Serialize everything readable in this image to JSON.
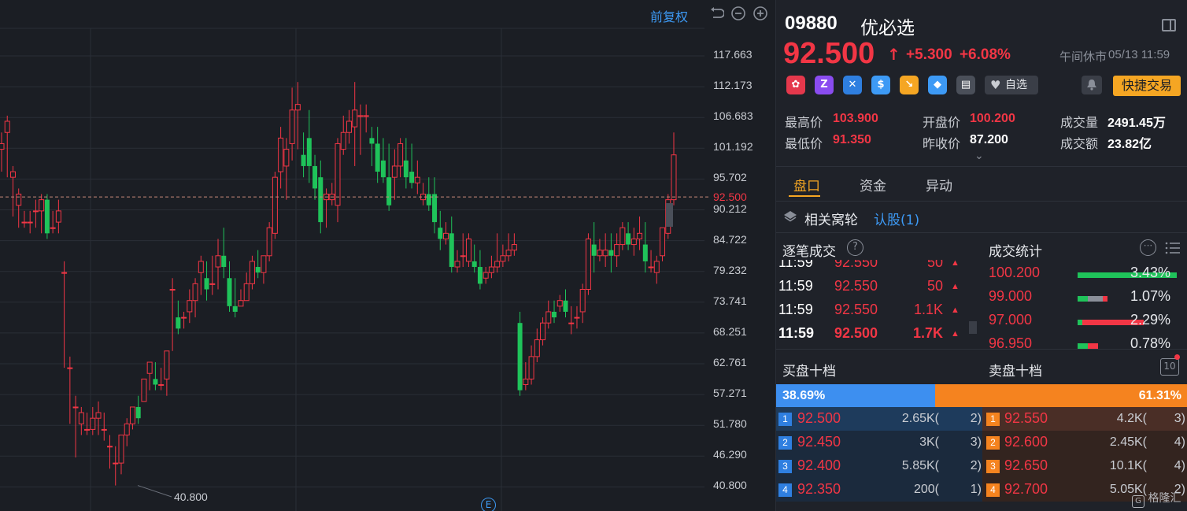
{
  "chart": {
    "adjust_label": "前复权",
    "y_ticks": [
      "117.663",
      "112.173",
      "106.683",
      "101.192",
      "95.702",
      "90.212",
      "84.722",
      "79.232",
      "73.741",
      "68.251",
      "62.761",
      "57.271",
      "51.780",
      "46.290",
      "40.800"
    ],
    "current_price_tag": "92.500",
    "low_label": "40.800",
    "event_icon": "E",
    "colors": {
      "up": "#f23645",
      "down": "#1fc35a",
      "grid": "#2a2e36"
    }
  },
  "chart_data": {
    "type": "candlestick",
    "y_range": [
      40.8,
      117.663
    ],
    "current_price": 92.5,
    "candles": [
      [
        101,
        104,
        102,
        97
      ],
      [
        104,
        107,
        106,
        96
      ],
      [
        96,
        98,
        97,
        89
      ],
      [
        91,
        94,
        93,
        87
      ],
      [
        88,
        90,
        88,
        87
      ],
      [
        88,
        90,
        88,
        86
      ],
      [
        90,
        92,
        90,
        87
      ],
      [
        90,
        93,
        92,
        86
      ],
      [
        92,
        93,
        86,
        85
      ],
      [
        87,
        90,
        87,
        86
      ],
      [
        88,
        92,
        90,
        86
      ],
      [
        79,
        81,
        79,
        62
      ],
      [
        62,
        64,
        62,
        52
      ],
      [
        55,
        57,
        55,
        46
      ],
      [
        52,
        55,
        54,
        50
      ],
      [
        51,
        54,
        51,
        50
      ],
      [
        51,
        55,
        53,
        50
      ],
      [
        53,
        56,
        54,
        50
      ],
      [
        51,
        54,
        51,
        49
      ],
      [
        48,
        50,
        48,
        44
      ],
      [
        45,
        48,
        45,
        41
      ],
      [
        45,
        50,
        50,
        43
      ],
      [
        50,
        53,
        52,
        48
      ],
      [
        52,
        55,
        55,
        51
      ],
      [
        55,
        57,
        53,
        52
      ],
      [
        56,
        60,
        60,
        56
      ],
      [
        61,
        63,
        63,
        58
      ],
      [
        60,
        63,
        59,
        58
      ],
      [
        59,
        62,
        59,
        58
      ],
      [
        60,
        65,
        65,
        57
      ],
      [
        76,
        78,
        76,
        65
      ],
      [
        71,
        74,
        69,
        68
      ],
      [
        71,
        72,
        71,
        69
      ],
      [
        72,
        76,
        74,
        70
      ],
      [
        74,
        78,
        77,
        71
      ],
      [
        79,
        82,
        81,
        75
      ],
      [
        78,
        81,
        76,
        74
      ],
      [
        77,
        82,
        77,
        75
      ],
      [
        80,
        85,
        82,
        76
      ],
      [
        82,
        87,
        80,
        78
      ],
      [
        78,
        81,
        73,
        72
      ],
      [
        73,
        78,
        72,
        71
      ],
      [
        73,
        76,
        74,
        73
      ],
      [
        74,
        79,
        77,
        74
      ],
      [
        77,
        82,
        81,
        76
      ],
      [
        80,
        83,
        79,
        78
      ],
      [
        79,
        82,
        82,
        77
      ],
      [
        82,
        88,
        87,
        81
      ],
      [
        86,
        97,
        96,
        85
      ],
      [
        97,
        105,
        103,
        94
      ],
      [
        98,
        103,
        101,
        92
      ],
      [
        102,
        112,
        108,
        99
      ],
      [
        108,
        113,
        109,
        101
      ],
      [
        100,
        104,
        98,
        96
      ],
      [
        103,
        108,
        98,
        95
      ],
      [
        98,
        100,
        94,
        92
      ],
      [
        96,
        99,
        88,
        86
      ],
      [
        92,
        94,
        93,
        87
      ],
      [
        92,
        95,
        93,
        91
      ],
      [
        91,
        103,
        102,
        88
      ],
      [
        101,
        107,
        104,
        100
      ],
      [
        104,
        108,
        106,
        102
      ],
      [
        105,
        113,
        108,
        98
      ],
      [
        107,
        109,
        107,
        100
      ],
      [
        107,
        109,
        107,
        104
      ],
      [
        103,
        105,
        102,
        98
      ],
      [
        102,
        105,
        97,
        95
      ],
      [
        99,
        103,
        96,
        95
      ],
      [
        96,
        102,
        91,
        90
      ],
      [
        96,
        101,
        98,
        92
      ],
      [
        98,
        103,
        102,
        96
      ],
      [
        99,
        103,
        96,
        94
      ],
      [
        97,
        102,
        95,
        94
      ],
      [
        95,
        99,
        96,
        93
      ],
      [
        92,
        95,
        93,
        91
      ],
      [
        93,
        96,
        91,
        90
      ],
      [
        93,
        96,
        88,
        86
      ],
      [
        87,
        90,
        85,
        83
      ],
      [
        85,
        88,
        86,
        84
      ],
      [
        86,
        89,
        80,
        79
      ],
      [
        80,
        83,
        81,
        79
      ],
      [
        82,
        86,
        82,
        80
      ],
      [
        81,
        86,
        85,
        80
      ],
      [
        81,
        84,
        80,
        79
      ],
      [
        80,
        83,
        77,
        76
      ],
      [
        78,
        80,
        79,
        77
      ],
      [
        79,
        82,
        80,
        78
      ],
      [
        80,
        86,
        81,
        79
      ],
      [
        81,
        84,
        82,
        80
      ],
      [
        82,
        86,
        83,
        81
      ],
      [
        83,
        86,
        84,
        82
      ],
      [
        70,
        72,
        58,
        57
      ],
      [
        59,
        63,
        60,
        58
      ],
      [
        60,
        66,
        64,
        59
      ],
      [
        64,
        69,
        67,
        63
      ],
      [
        67,
        71,
        70,
        66
      ],
      [
        70,
        74,
        72,
        69
      ],
      [
        72,
        74,
        71,
        70
      ],
      [
        73,
        75,
        74,
        72
      ],
      [
        74,
        76,
        72,
        71
      ],
      [
        70,
        73,
        70,
        68
      ],
      [
        71,
        73,
        71,
        69
      ],
      [
        72,
        77,
        76,
        70
      ],
      [
        76,
        86,
        85,
        75
      ],
      [
        84,
        88,
        82,
        79
      ],
      [
        82,
        85,
        83,
        81
      ],
      [
        82,
        86,
        83,
        80
      ],
      [
        83,
        86,
        82,
        79
      ],
      [
        82,
        86,
        84,
        80
      ],
      [
        84,
        88,
        87,
        83
      ],
      [
        86,
        88,
        84,
        83
      ],
      [
        84,
        87,
        85,
        82
      ],
      [
        85,
        89,
        86,
        83
      ],
      [
        84,
        88,
        81,
        79
      ],
      [
        80,
        83,
        80,
        79
      ],
      [
        79,
        82,
        81,
        77
      ],
      [
        82,
        86,
        87,
        81
      ],
      [
        86,
        93,
        92,
        85
      ],
      [
        92,
        104,
        100,
        91
      ]
    ]
  },
  "quote": {
    "code": "09880",
    "name": "优必选",
    "price": "92.500",
    "change": "+5.300",
    "change_pct": "+6.08%",
    "status": "午间休市",
    "datetime": "05/13 11:59",
    "high_label": "最高价",
    "high": "103.900",
    "low_label": "最低价",
    "low": "91.350",
    "open_label": "开盘价",
    "open": "100.200",
    "prev_label": "昨收价",
    "prev": "87.200",
    "vol_label": "成交量",
    "vol": "2491.45万",
    "amt_label": "成交额",
    "amt": "23.82亿"
  },
  "badges": [
    {
      "text": "✿",
      "color": "#e5384c"
    },
    {
      "text": "Z",
      "color": "#8a4cf0"
    },
    {
      "text": "✕",
      "color": "#2f7fe0"
    },
    {
      "text": "$",
      "color": "#3d9af5"
    },
    {
      "text": "↘",
      "color": "#f5a623"
    },
    {
      "text": "◆",
      "color": "#3d9af5"
    },
    {
      "text": "▤",
      "color": "#4a4f59"
    }
  ],
  "actions": {
    "watch": "自选",
    "trade": "快捷交易"
  },
  "tabs": [
    "盘口",
    "资金",
    "异动"
  ],
  "related": {
    "title": "相关窝轮",
    "link": "认股(1)"
  },
  "ticks_title": "逐笔成交",
  "ticks": [
    {
      "time": "11:59",
      "price": "92.550",
      "vol": "50"
    },
    {
      "time": "11:59",
      "price": "92.550",
      "vol": "50"
    },
    {
      "time": "11:59",
      "price": "92.550",
      "vol": "1.1K"
    },
    {
      "time": "11:59",
      "price": "92.500",
      "vol": "1.7K"
    }
  ],
  "stats_title": "成交统计",
  "stats": [
    {
      "price": "100.200",
      "pct": "3.43%",
      "green": 1.0,
      "gray": 0.0,
      "red": 0.0
    },
    {
      "price": "99.000",
      "pct": "1.07%",
      "green": 0.1,
      "gray": 0.15,
      "red": 0.05
    },
    {
      "price": "97.000",
      "pct": "2.29%",
      "green": 0.05,
      "gray": 0.0,
      "red": 0.62
    },
    {
      "price": "96.950",
      "pct": "0.78%",
      "green": 0.1,
      "gray": 0.0,
      "red": 0.1
    }
  ],
  "book": {
    "bid_title": "买盘十档",
    "ask_title": "卖盘十档",
    "bid_pct": "38.69%",
    "ask_pct": "61.31%",
    "bid_ratio": 0.3869,
    "ten_label": "10",
    "rows": [
      {
        "lvl": "1",
        "bid": "92.500",
        "bid_vol": "2.65K(",
        "bid_n": "2)",
        "ask": "92.550",
        "ask_vol": "4.2K(",
        "ask_n": "3)"
      },
      {
        "lvl": "2",
        "bid": "92.450",
        "bid_vol": "3K(",
        "bid_n": "3)",
        "ask": "92.600",
        "ask_vol": "2.45K(",
        "ask_n": "4)"
      },
      {
        "lvl": "3",
        "bid": "92.400",
        "bid_vol": "5.85K(",
        "bid_n": "2)",
        "ask": "92.650",
        "ask_vol": "10.1K(",
        "ask_n": "4)"
      },
      {
        "lvl": "4",
        "bid": "92.350",
        "bid_vol": "200(",
        "bid_n": "1)",
        "ask": "92.700",
        "ask_vol": "5.05K(",
        "ask_n": "2)"
      }
    ]
  },
  "watermark": "格隆汇"
}
